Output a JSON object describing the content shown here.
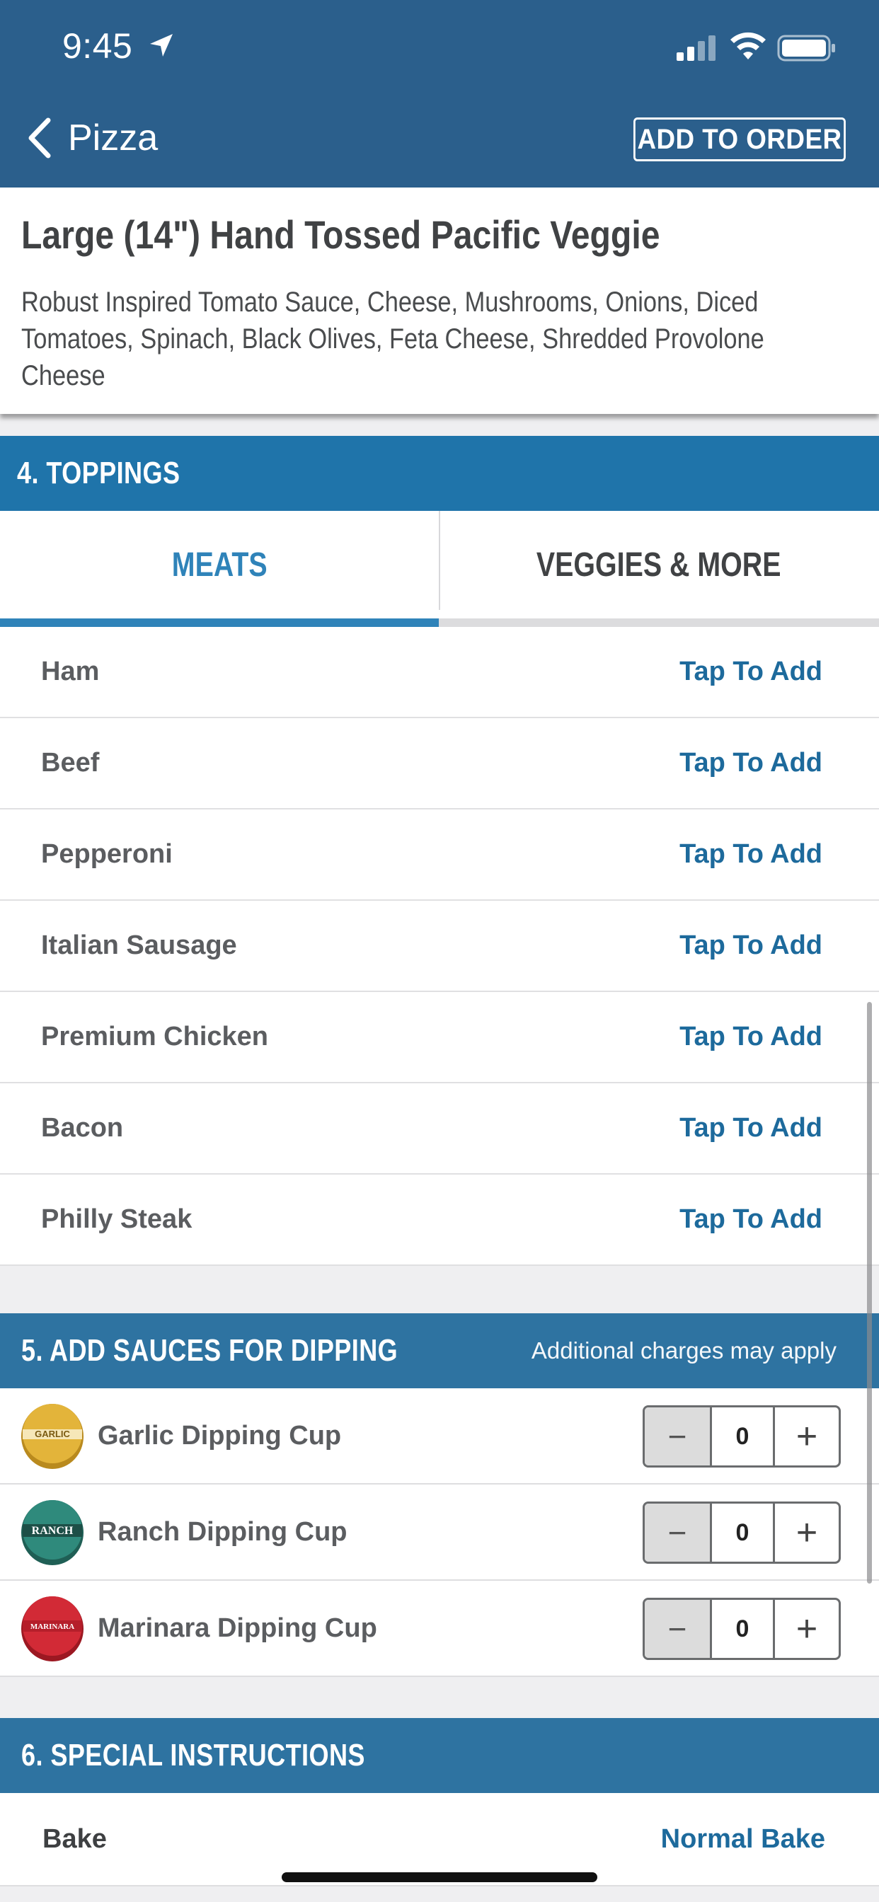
{
  "status_bar": {
    "time": "9:45"
  },
  "nav": {
    "back_label": "Pizza",
    "action_label": "ADD TO ORDER"
  },
  "product": {
    "title": "Large (14\") Hand Tossed Pacific Veggie",
    "description": "Robust Inspired Tomato Sauce, Cheese, Mushrooms, Onions, Diced Tomatoes, Spinach, Black Olives, Feta Cheese, Shredded Provolone Cheese"
  },
  "toppings_section": {
    "title": "4. TOPPINGS",
    "tabs": [
      {
        "label": "MEATS",
        "active": true
      },
      {
        "label": "VEGGIES & MORE",
        "active": false
      }
    ],
    "items": [
      {
        "name": "Ham",
        "action": "Tap To Add"
      },
      {
        "name": "Beef",
        "action": "Tap To Add"
      },
      {
        "name": "Pepperoni",
        "action": "Tap To Add"
      },
      {
        "name": "Italian Sausage",
        "action": "Tap To Add"
      },
      {
        "name": "Premium Chicken",
        "action": "Tap To Add"
      },
      {
        "name": "Bacon",
        "action": "Tap To Add"
      },
      {
        "name": "Philly Steak",
        "action": "Tap To Add"
      }
    ]
  },
  "sauces_section": {
    "title": "5. ADD SAUCES FOR DIPPING",
    "note": "Additional charges may apply",
    "items": [
      {
        "name": "Garlic Dipping Cup",
        "qty": "0",
        "cup_label": "GARLIC",
        "cup_color": "#e3b43a"
      },
      {
        "name": "Ranch Dipping Cup",
        "qty": "0",
        "cup_label": "RANCH",
        "cup_color": "#2f8a7c"
      },
      {
        "name": "Marinara Dipping Cup",
        "qty": "0",
        "cup_label": "MARINARA",
        "cup_color": "#d22a36"
      }
    ],
    "minus_symbol": "−",
    "plus_symbol": "+"
  },
  "special_section": {
    "title": "6. SPECIAL INSTRUCTIONS",
    "bake_label": "Bake",
    "bake_value": "Normal Bake"
  },
  "colors": {
    "header": "#2b5f8c",
    "section": "#1f74aa",
    "link": "#1d6a9c",
    "active_tab": "#2f83b9"
  }
}
